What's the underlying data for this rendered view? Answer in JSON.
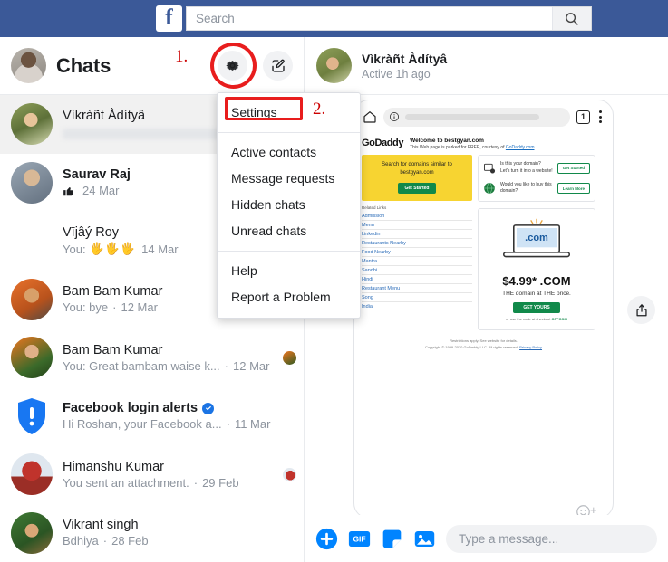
{
  "topbar": {
    "logo_letter": "f",
    "search": {
      "placeholder": "Search",
      "value": "",
      "icon": "search-icon"
    }
  },
  "chats_panel": {
    "title": "Chats",
    "annotation_1": "1.",
    "gear_icon": "gear-icon",
    "compose_icon": "compose-icon",
    "items": [
      {
        "name": "Vìkràñt Àdítyâ",
        "snippet": "",
        "snippet_redacted": true,
        "time": "",
        "unread": false,
        "active": true,
        "seen_avatar": false,
        "verified": false,
        "avatar_kind": "photo-holi"
      },
      {
        "name": "Saurav Raj",
        "snippet": "",
        "reaction": "thumbs-up",
        "time": "24 Mar",
        "unread": true,
        "active": false,
        "seen_avatar": false,
        "verified": false,
        "avatar_kind": "photo-man-blue"
      },
      {
        "name": "Vījâý Roy",
        "snippet": "You:",
        "reaction": "raised-hands",
        "time": "14 Mar",
        "unread": false,
        "active": false,
        "seen_avatar": false,
        "verified": false,
        "avatar_kind": "photo-glasses"
      },
      {
        "name": "Bam Bam Kumar",
        "snippet": "You: bye",
        "time": "12 Mar",
        "unread": false,
        "active": false,
        "seen_avatar": true,
        "verified": false,
        "avatar_kind": "photo-orange-phone"
      },
      {
        "name": "Bam Bam Kumar",
        "snippet": "You: Great bambam waise k...",
        "time": "12 Mar",
        "unread": false,
        "active": false,
        "seen_avatar": true,
        "verified": false,
        "avatar_kind": "photo-orange-green"
      },
      {
        "name": "Facebook login alerts",
        "snippet": "Hi Roshan, your Facebook a...",
        "time": "11 Mar",
        "unread": true,
        "active": false,
        "seen_avatar": false,
        "verified": true,
        "avatar_kind": "alert-shield"
      },
      {
        "name": "Himanshu Kumar",
        "snippet": "You sent an attachment.",
        "time": "29 Feb",
        "unread": false,
        "active": false,
        "seen_avatar": true,
        "verified": false,
        "avatar_kind": "photo-heart"
      },
      {
        "name": "Vikrant singh",
        "snippet": "Bdhiya",
        "time": "28 Feb",
        "unread": false,
        "active": false,
        "seen_avatar": false,
        "verified": false,
        "avatar_kind": "photo-green"
      }
    ]
  },
  "menu": {
    "annotation_2": "2.",
    "highlighted": "Settings",
    "group1": [
      "Settings"
    ],
    "group2": [
      "Active contacts",
      "Message requests",
      "Hidden chats",
      "Unread chats"
    ],
    "group3": [
      "Help",
      "Report a Problem"
    ]
  },
  "thread": {
    "name": "Vìkràñt Àdítyâ",
    "status": "Active 1h ago",
    "share_icon": "share-icon",
    "emoji_add_icon": "emoji-add-icon",
    "link_preview": {
      "browser": {
        "home_icon": "home-icon",
        "info_icon": "info-icon",
        "url_redacted": true,
        "tab_count": "1",
        "menu_icon": "kebab-menu-icon"
      },
      "brand": "GoDaddy",
      "welcome_title": "Welcome to bestgyan.com",
      "welcome_sub": "This Web page is parked for FREE, courtesy of",
      "welcome_sub_link": "GoDaddy.com",
      "search_panel": {
        "line1": "Search for domains similar to",
        "line2": "bestgyan.com",
        "button": "Get Started"
      },
      "related_links_title": "Related Links",
      "related_links": [
        "Admission",
        "Menu",
        "Linkedin",
        "Restaurants Nearby",
        "Food Nearby",
        "Mantra",
        "Sandhi",
        "Hindi",
        "Restaurant Menu",
        "Song",
        "India"
      ],
      "offers": [
        {
          "text_line1": "Is this your domain?",
          "text_line2": "Let's turn it into a website!",
          "button": "Get Started"
        },
        {
          "text_line1": "Would you like to buy this",
          "text_line2": "domain?",
          "button": "Learn More"
        }
      ],
      "promo": {
        "laptop_label": ".com",
        "price": "$4.99* .COM",
        "tagline": "THE domain at THE price.",
        "button": "GET YOURS",
        "code_text": "or use the code at checkout",
        "code": "OFFCOM"
      },
      "footer_line1": "Restrictions apply. See website for details.",
      "footer_line2": "Copyright © 1999-2020 GoDaddy LLC. All rights reserved.",
      "footer_link": "Privacy Policy"
    }
  },
  "composer": {
    "placeholder": "Type a message...",
    "value": "",
    "icons": [
      "plus-icon",
      "gif-icon",
      "sticker-icon",
      "photo-icon"
    ],
    "gif_label": "GIF"
  },
  "colors": {
    "fb_blue": "#3b5998",
    "accent_blue": "#0084ff",
    "annotation_red": "#e81d1d",
    "verified_blue": "#1b74e4"
  }
}
